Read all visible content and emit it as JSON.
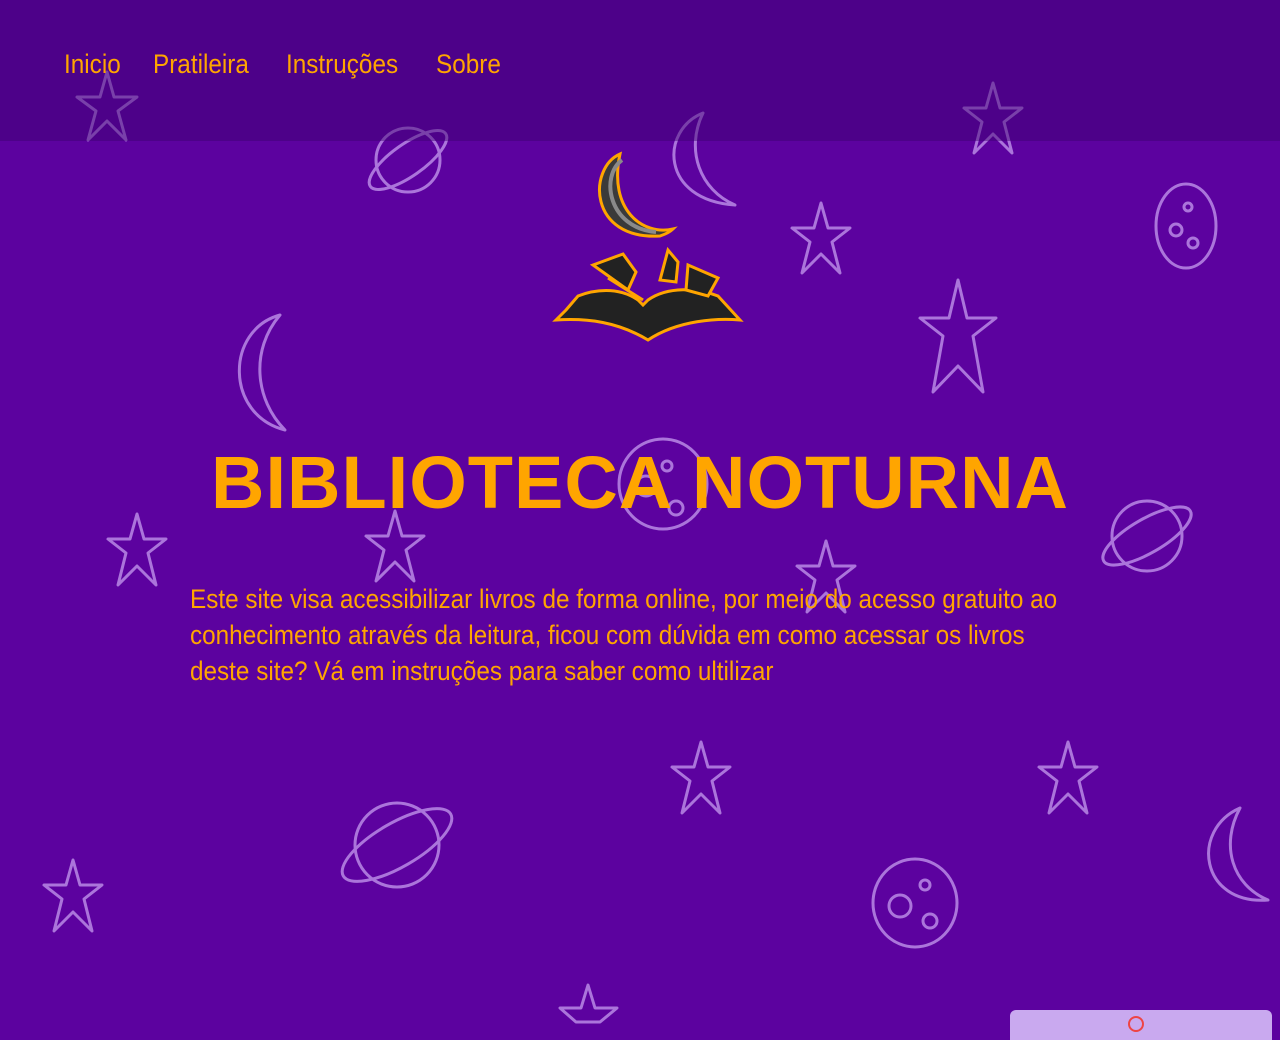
{
  "nav": {
    "items": [
      {
        "label": "Inicio"
      },
      {
        "label": "Pratileira"
      },
      {
        "label": "Instruções"
      },
      {
        "label": "Sobre"
      }
    ]
  },
  "hero": {
    "title": "BIBLIOTECA NOTURNA",
    "logo_icon": "moon-book-icon",
    "description": "Este site visa acessibilizar livros de forma online, por meio do acesso gratuito ao conhecimento através da leitura, ficou com dúvida em como acessar os livros deste site? Vá em instruções para saber como ultilizar"
  },
  "colors": {
    "background": "#5c029f",
    "accent": "#ffa500",
    "doodle": "#b98ae6"
  },
  "background_icons": [
    "star-icon",
    "planet-icon",
    "moon-icon",
    "asteroid-icon"
  ]
}
